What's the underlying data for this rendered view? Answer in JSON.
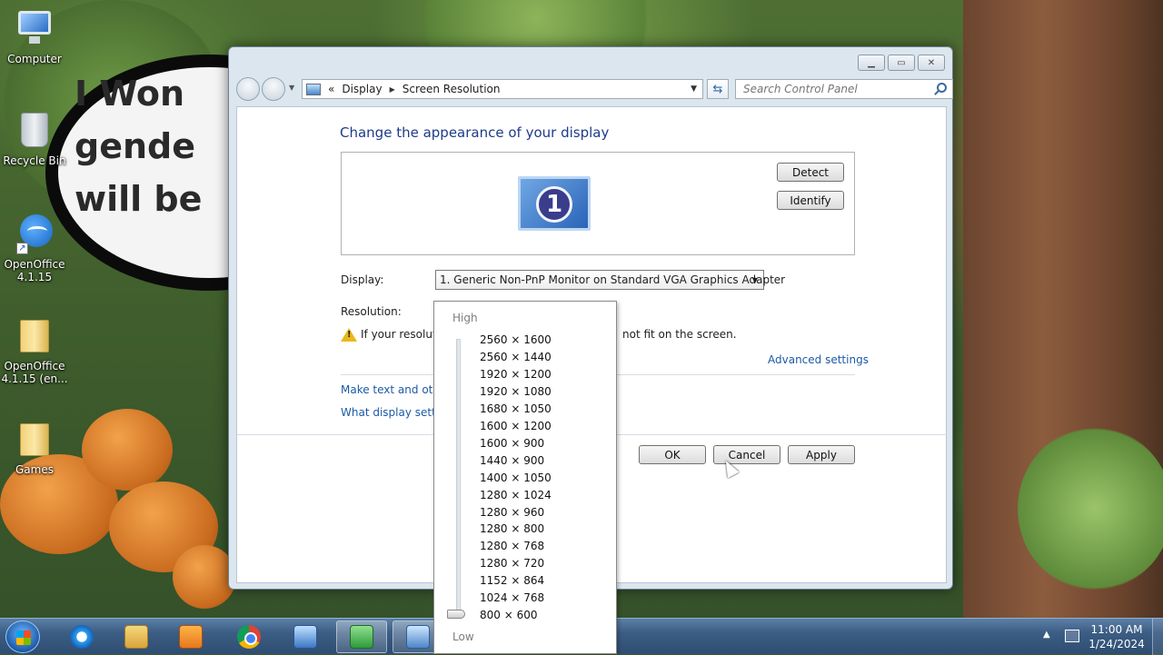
{
  "desktop": {
    "wallpaper_text": [
      "I Won",
      "gende",
      "will be"
    ],
    "icons": [
      {
        "label": "Computer",
        "icon": "computer-icon"
      },
      {
        "label": "Recycle Bin",
        "icon": "recycle-bin-icon"
      },
      {
        "label": "OpenOffice 4.1.15",
        "icon": "openoffice-icon"
      },
      {
        "label": "OpenOffice 4.1.15 (en...",
        "icon": "folder-icon"
      },
      {
        "label": "Games",
        "icon": "folder-icon"
      }
    ]
  },
  "window": {
    "breadcrumb": {
      "overflow": "«",
      "items": [
        "Display",
        "Screen Resolution"
      ]
    },
    "search_placeholder": "Search Control Panel",
    "content": {
      "title": "Change the appearance of your display",
      "monitor_number": "1",
      "detect_label": "Detect",
      "identify_label": "Identify",
      "display_label": "Display:",
      "display_value": "1. Generic Non-PnP Monitor on Standard VGA Graphics Adapter",
      "resolution_label": "Resolution:",
      "warning_text_start": "If your resolutio",
      "warning_text_end": "not fit on the screen.",
      "advanced_settings": "Advanced settings",
      "link_text_size": "Make text and other",
      "link_display_settings": "What display setting"
    },
    "buttons": {
      "ok": "OK",
      "cancel": "Cancel",
      "apply": "Apply"
    }
  },
  "resolution_dropdown": {
    "high_label": "High",
    "low_label": "Low",
    "options": [
      "2560 × 1600",
      "2560 × 1440",
      "1920 × 1200",
      "1920 × 1080",
      "1680 × 1050",
      "1600 × 1200",
      "1600 × 900",
      "1440 × 900",
      "1400 × 1050",
      "1280 × 1024",
      "1280 × 960",
      "1280 × 800",
      "1280 × 768",
      "1280 × 720",
      "1152 × 864",
      "1024 × 768",
      "800 × 600"
    ],
    "selected": "800 × 600"
  },
  "taskbar": {
    "apps": [
      "internet-explorer-icon",
      "windows-explorer-icon",
      "media-player-icon",
      "chrome-icon",
      "network-icon",
      "green-app-icon",
      "control-panel-icon"
    ],
    "clock_time": "11:00 AM",
    "clock_date": "1/24/2024"
  }
}
